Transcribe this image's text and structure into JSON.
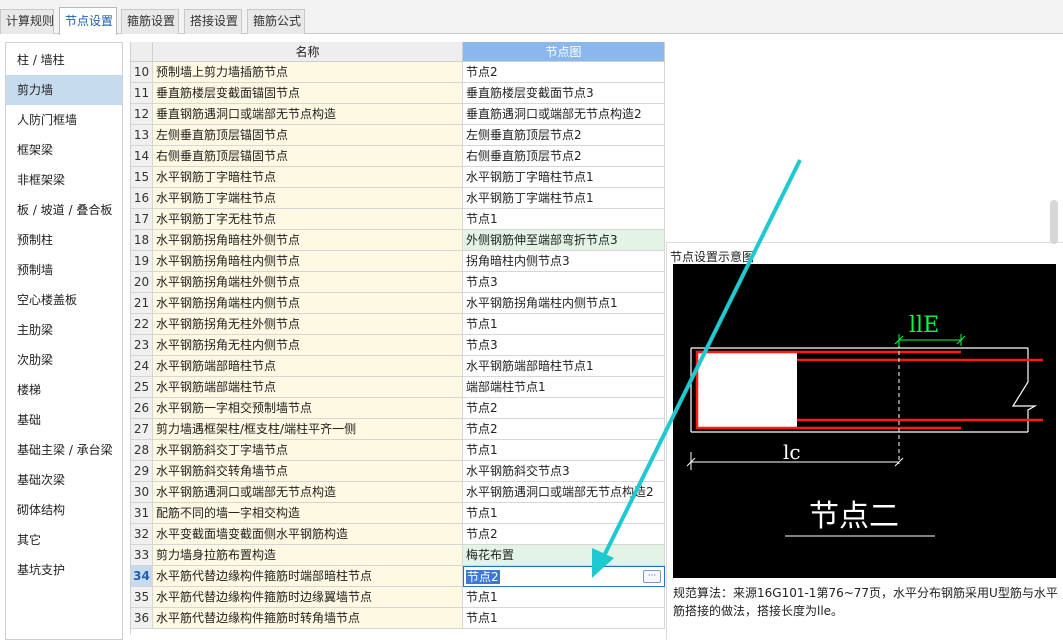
{
  "tabs": [
    {
      "label": "计算规则"
    },
    {
      "label": "节点设置"
    },
    {
      "label": "箍筋设置"
    },
    {
      "label": "搭接设置"
    },
    {
      "label": "箍筋公式"
    }
  ],
  "sidebar": {
    "items": [
      {
        "label": "柱 / 墙柱"
      },
      {
        "label": "剪力墙"
      },
      {
        "label": "人防门框墙"
      },
      {
        "label": "框架梁"
      },
      {
        "label": "非框架梁"
      },
      {
        "label": "板 / 坡道 / 叠合板"
      },
      {
        "label": "预制柱"
      },
      {
        "label": "预制墙"
      },
      {
        "label": "空心楼盖板"
      },
      {
        "label": "主肋梁"
      },
      {
        "label": "次肋梁"
      },
      {
        "label": "楼梯"
      },
      {
        "label": "基础"
      },
      {
        "label": "基础主梁 / 承台梁"
      },
      {
        "label": "基础次梁"
      },
      {
        "label": "砌体结构"
      },
      {
        "label": "其它"
      },
      {
        "label": "基坑支护"
      }
    ]
  },
  "grid": {
    "headers": {
      "name": "名称",
      "node": "节点图"
    },
    "rows": [
      {
        "num": "10",
        "name": "预制墙上剪力墙插筋节点",
        "node": "节点2"
      },
      {
        "num": "11",
        "name": "垂直筋楼层变截面锚固节点",
        "node": "垂直筋楼层变截面节点3"
      },
      {
        "num": "12",
        "name": "垂直钢筋遇洞口或端部无节点构造",
        "node": "垂直筋遇洞口或端部无节点构造2"
      },
      {
        "num": "13",
        "name": "左侧垂直筋顶层锚固节点",
        "node": "左侧垂直筋顶层节点2"
      },
      {
        "num": "14",
        "name": "右侧垂直筋顶层锚固节点",
        "node": "右侧垂直筋顶层节点2"
      },
      {
        "num": "15",
        "name": "水平钢筋丁字暗柱节点",
        "node": "水平钢筋丁字暗柱节点1"
      },
      {
        "num": "16",
        "name": "水平钢筋丁字端柱节点",
        "node": "水平钢筋丁字端柱节点1"
      },
      {
        "num": "17",
        "name": "水平钢筋丁字无柱节点",
        "node": "节点1"
      },
      {
        "num": "18",
        "name": "水平钢筋拐角暗柱外侧节点",
        "node": "外侧钢筋伸至端部弯折节点3"
      },
      {
        "num": "19",
        "name": "水平钢筋拐角暗柱内侧节点",
        "node": "拐角暗柱内侧节点3"
      },
      {
        "num": "20",
        "name": "水平钢筋拐角端柱外侧节点",
        "node": "节点3"
      },
      {
        "num": "21",
        "name": "水平钢筋拐角端柱内侧节点",
        "node": "水平钢筋拐角端柱内侧节点1"
      },
      {
        "num": "22",
        "name": "水平钢筋拐角无柱外侧节点",
        "node": "节点1"
      },
      {
        "num": "23",
        "name": "水平钢筋拐角无柱内侧节点",
        "node": "节点3"
      },
      {
        "num": "24",
        "name": "水平钢筋端部暗柱节点",
        "node": "水平钢筋端部暗柱节点1"
      },
      {
        "num": "25",
        "name": "水平钢筋端部端柱节点",
        "node": "端部端柱节点1"
      },
      {
        "num": "26",
        "name": "水平钢筋一字相交预制墙节点",
        "node": "节点2"
      },
      {
        "num": "27",
        "name": "剪力墙遇框架柱/框支柱/端柱平齐一侧",
        "node": "节点2"
      },
      {
        "num": "28",
        "name": "水平钢筋斜交丁字墙节点",
        "node": "节点1"
      },
      {
        "num": "29",
        "name": "水平钢筋斜交转角墙节点",
        "node": "水平钢筋斜交节点3"
      },
      {
        "num": "30",
        "name": "水平钢筋遇洞口或端部无节点构造",
        "node": "水平钢筋遇洞口或端部无节点构造2"
      },
      {
        "num": "31",
        "name": "配筋不同的墙一字相交构造",
        "node": "节点1"
      },
      {
        "num": "32",
        "name": "水平变截面墙变截面侧水平钢筋构造",
        "node": "节点2"
      },
      {
        "num": "33",
        "name": "剪力墙身拉筋布置构造",
        "node": "梅花布置"
      },
      {
        "num": "34",
        "name": "水平筋代替边缘构件箍筋时端部暗柱节点",
        "node": "节点2"
      },
      {
        "num": "35",
        "name": "水平筋代替边缘构件箍筋时边缘翼墙节点",
        "node": "节点1"
      },
      {
        "num": "36",
        "name": "水平筋代替边缘构件箍筋时转角墙节点",
        "node": "节点1"
      }
    ],
    "ellipsis": "···"
  },
  "diagram": {
    "title": "节点设置示意图",
    "label_lle": "llE",
    "label_lc": "lc",
    "caption": "节点二",
    "colors": {
      "background": "#000000",
      "rebar": "#ff1a1a",
      "outline": "#ffffff",
      "dimension": "#00ff40"
    }
  },
  "note": "规范算法：来源16G101-1第76~77页，水平分布钢筋采用U型筋与水平筋搭接的做法，搭接长度为lle。",
  "accent": "#8ab8ec",
  "arrow_color": "#1fc9d0"
}
